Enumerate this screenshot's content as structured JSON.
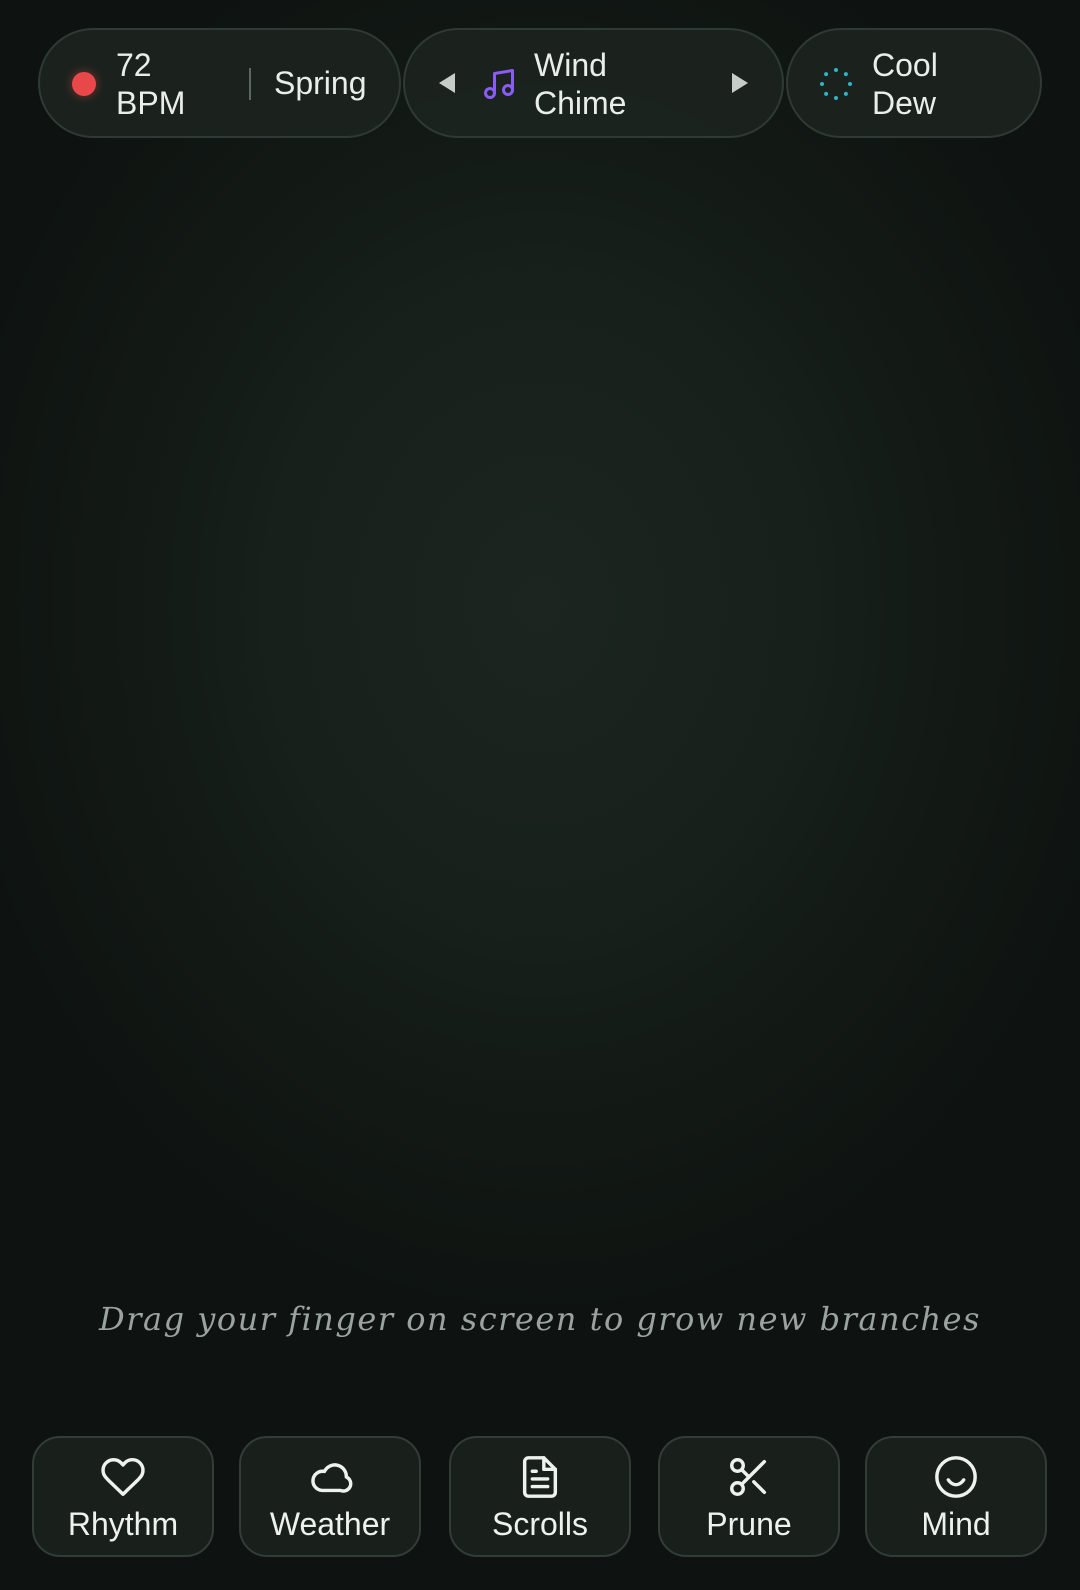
{
  "status": {
    "bpm_label": "72 BPM",
    "season": "Spring",
    "recording_color": "#e8484a"
  },
  "sound": {
    "name": "Wind Chime",
    "icon": "music-note-icon",
    "accent": "#8a5cf6"
  },
  "weather": {
    "name": "Cool Dew",
    "icon": "dew-dots-icon",
    "accent": "#2bb6c9"
  },
  "hint": "Drag your finger on screen to grow new branches",
  "tools": [
    {
      "label": "Rhythm",
      "icon": "heart-icon"
    },
    {
      "label": "Weather",
      "icon": "cloud-icon"
    },
    {
      "label": "Scrolls",
      "icon": "document-icon"
    },
    {
      "label": "Prune",
      "icon": "scissors-icon"
    },
    {
      "label": "Mind",
      "icon": "smile-icon"
    }
  ]
}
